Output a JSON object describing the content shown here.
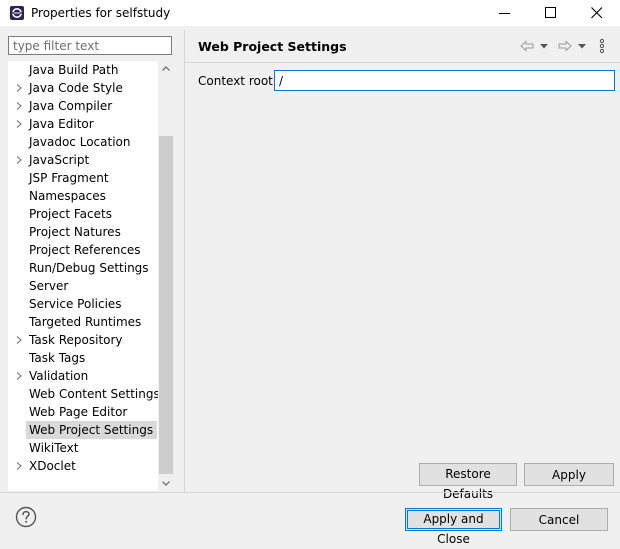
{
  "window": {
    "title": "Properties for selfstudy",
    "app_icon": "eclipse-icon",
    "controls": [
      "minimize-icon",
      "maximize-icon",
      "close-icon"
    ]
  },
  "filter": {
    "placeholder": "type filter text",
    "value": ""
  },
  "tree": {
    "items": [
      {
        "label": "Java Build Path",
        "expandable": false
      },
      {
        "label": "Java Code Style",
        "expandable": true
      },
      {
        "label": "Java Compiler",
        "expandable": true
      },
      {
        "label": "Java Editor",
        "expandable": true
      },
      {
        "label": "Javadoc Location",
        "expandable": false
      },
      {
        "label": "JavaScript",
        "expandable": true
      },
      {
        "label": "JSP Fragment",
        "expandable": false
      },
      {
        "label": "Namespaces",
        "expandable": false
      },
      {
        "label": "Project Facets",
        "expandable": false
      },
      {
        "label": "Project Natures",
        "expandable": false
      },
      {
        "label": "Project References",
        "expandable": false
      },
      {
        "label": "Run/Debug Settings",
        "expandable": false
      },
      {
        "label": "Server",
        "expandable": false
      },
      {
        "label": "Service Policies",
        "expandable": false
      },
      {
        "label": "Targeted Runtimes",
        "expandable": false
      },
      {
        "label": "Task Repository",
        "expandable": true
      },
      {
        "label": "Task Tags",
        "expandable": false
      },
      {
        "label": "Validation",
        "expandable": true
      },
      {
        "label": "Web Content Settings",
        "expandable": false
      },
      {
        "label": "Web Page Editor",
        "expandable": false
      },
      {
        "label": "Web Project Settings",
        "expandable": false,
        "selected": true
      },
      {
        "label": "WikiText",
        "expandable": false
      },
      {
        "label": "XDoclet",
        "expandable": true
      }
    ]
  },
  "page": {
    "title": "Web Project Settings",
    "nav_icons": [
      "back-arrow-icon",
      "back-dropdown-icon",
      "forward-arrow-icon",
      "forward-dropdown-icon",
      "view-menu-icon"
    ],
    "context_root_label": "Context root:",
    "context_root_value": "/",
    "restore_defaults_label": "Restore Defaults",
    "apply_label": "Apply"
  },
  "footer": {
    "help_icon": "help-icon",
    "apply_close_label": "Apply and Close",
    "cancel_label": "Cancel"
  },
  "colors": {
    "focus_blue": "#0078d7",
    "selection_gray": "#d9d9d9",
    "button_face": "#e1e1e1",
    "dialog_background": "#f0f0f0"
  }
}
